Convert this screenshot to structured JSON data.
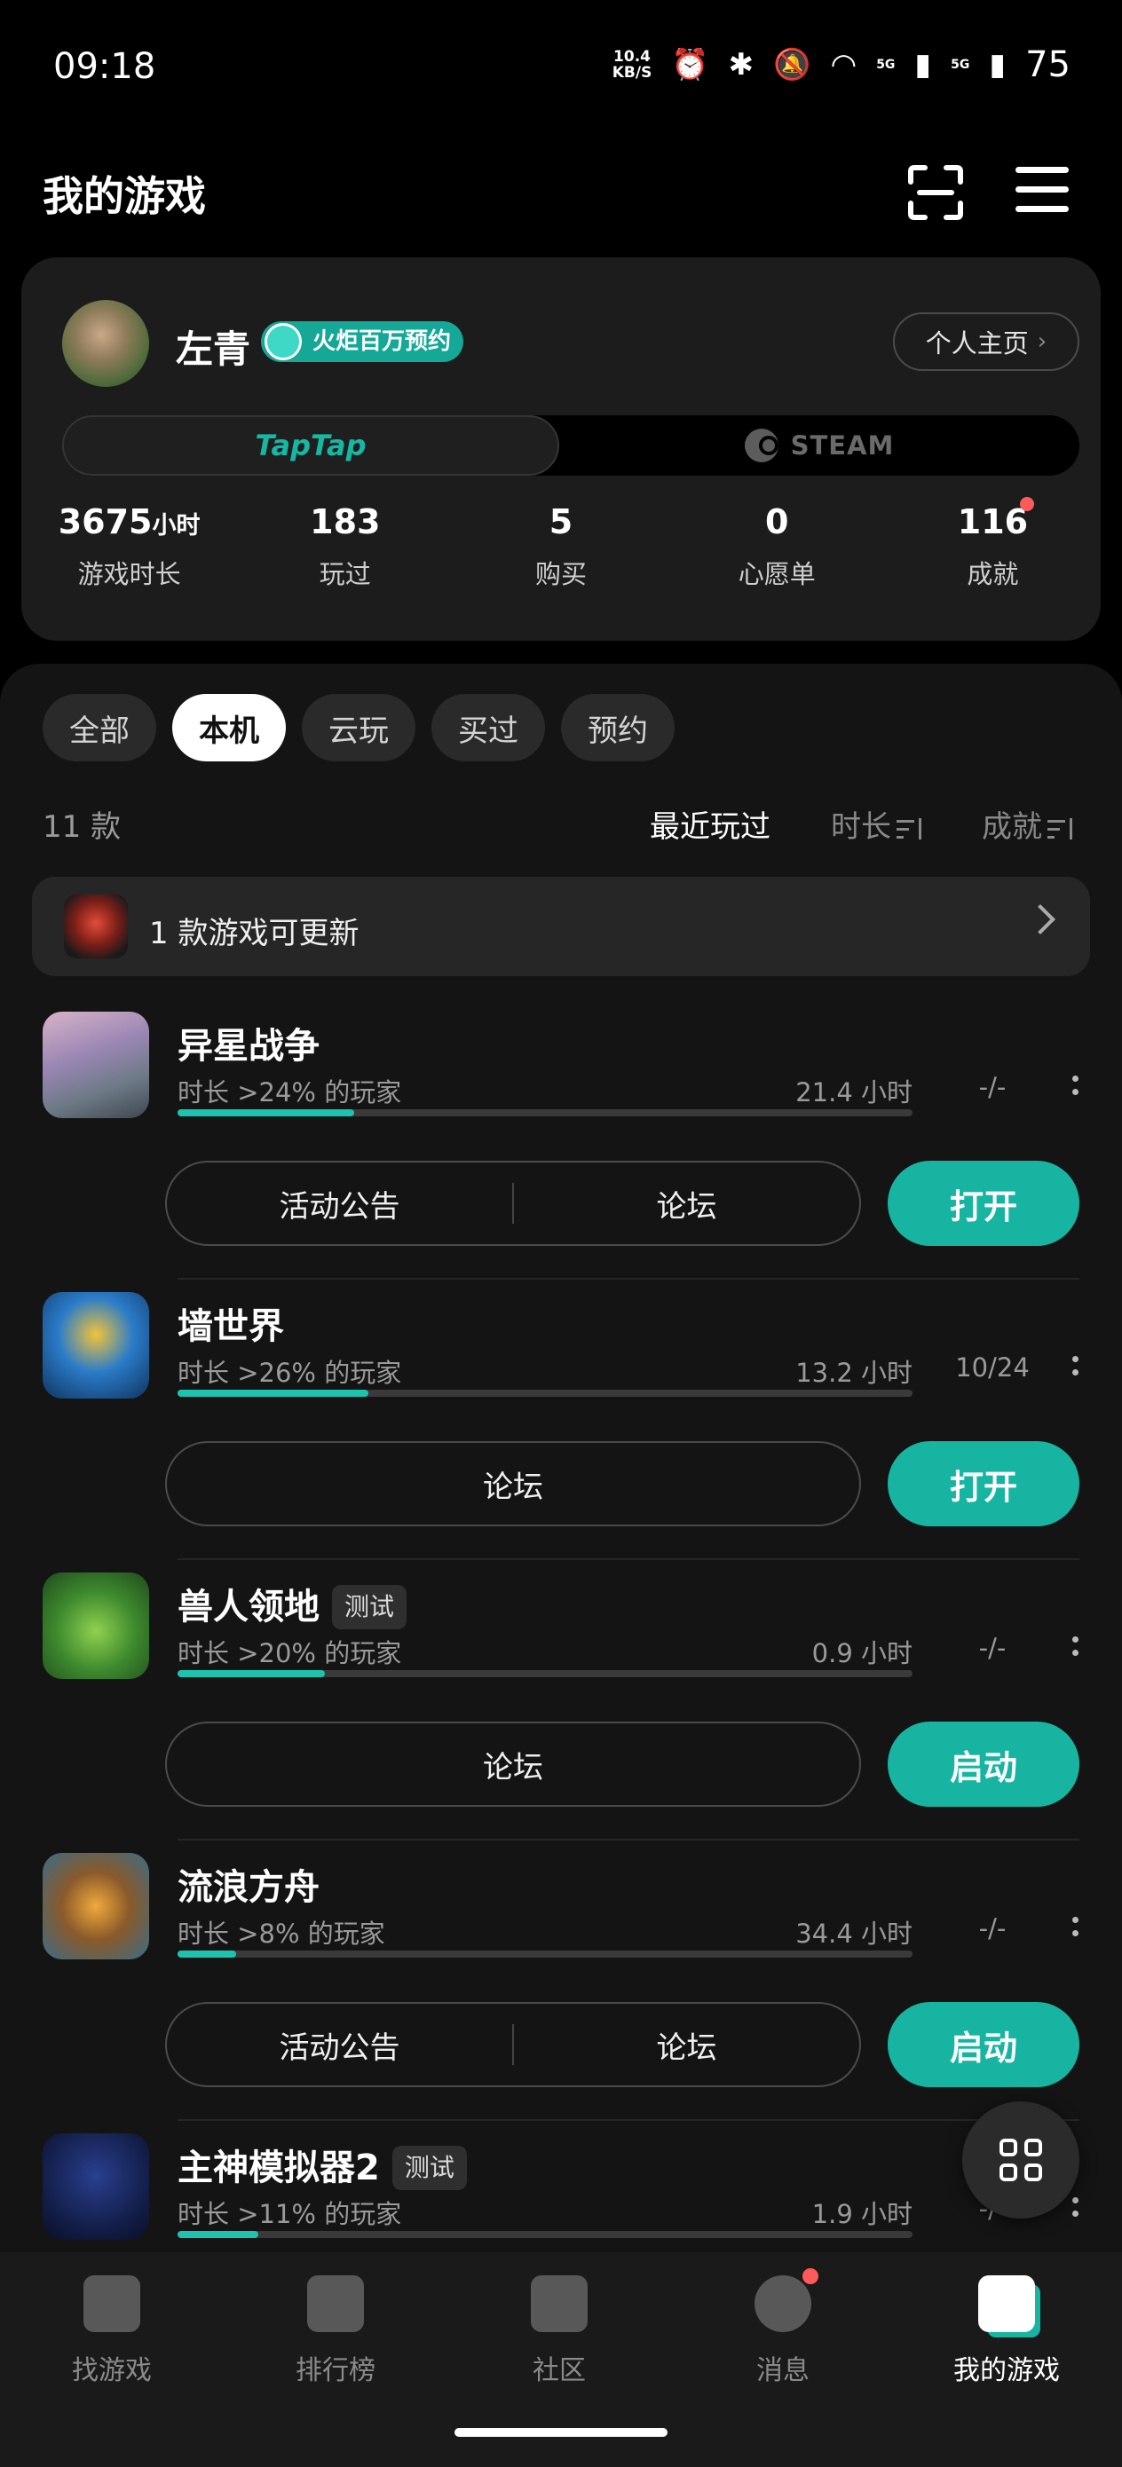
{
  "status_bar": {
    "time": "09:18",
    "net_speed_value": "10.4",
    "net_speed_unit": "KB/S",
    "sim1": "5G",
    "sim2": "5G",
    "battery": "75"
  },
  "header": {
    "title": "我的游戏"
  },
  "profile": {
    "username": "左青",
    "badge": "火炬百万预约",
    "home_button": "个人主页",
    "platforms": {
      "taptap": "TapTap",
      "steam": "STEAM"
    },
    "stats": [
      {
        "value": "3675",
        "unit": "小时",
        "label": "游戏时长"
      },
      {
        "value": "183",
        "unit": "",
        "label": "玩过"
      },
      {
        "value": "5",
        "unit": "",
        "label": "购买"
      },
      {
        "value": "0",
        "unit": "",
        "label": "心愿单"
      },
      {
        "value": "116",
        "unit": "",
        "label": "成就"
      }
    ]
  },
  "filters": {
    "tabs": [
      "全部",
      "本机",
      "云玩",
      "买过",
      "预约"
    ],
    "active_index": 1
  },
  "list_meta": {
    "count": "11 款",
    "sort_recent": "最近玩过",
    "sort_duration": "时长",
    "sort_achievement": "成就"
  },
  "update_bar": {
    "text": "1 款游戏可更新"
  },
  "games": [
    {
      "name": "异星战争",
      "tag": "",
      "percentile": "时长 >24% 的玩家",
      "progress": 0.24,
      "hours": "21.4 小时",
      "achievements": "-/-",
      "buttons": [
        "活动公告",
        "论坛"
      ],
      "action": "打开"
    },
    {
      "name": "墙世界",
      "tag": "",
      "percentile": "时长 >26% 的玩家",
      "progress": 0.26,
      "hours": "13.2 小时",
      "achievements": "10/24",
      "buttons": [
        "论坛"
      ],
      "action": "打开"
    },
    {
      "name": "兽人领地",
      "tag": "测试",
      "percentile": "时长 >20% 的玩家",
      "progress": 0.2,
      "hours": "0.9 小时",
      "achievements": "-/-",
      "buttons": [
        "论坛"
      ],
      "action": "启动"
    },
    {
      "name": "流浪方舟",
      "tag": "",
      "percentile": "时长 >8% 的玩家",
      "progress": 0.08,
      "hours": "34.4 小时",
      "achievements": "-/-",
      "buttons": [
        "活动公告",
        "论坛"
      ],
      "action": "启动"
    },
    {
      "name": "主神模拟器2",
      "tag": "测试",
      "percentile": "时长 >11% 的玩家",
      "progress": 0.11,
      "hours": "1.9 小时",
      "achievements": "-/-",
      "buttons": [],
      "action": ""
    }
  ],
  "bottom_nav": [
    {
      "label": "找游戏",
      "icon": "find-game-icon"
    },
    {
      "label": "排行榜",
      "icon": "ranking-icon"
    },
    {
      "label": "社区",
      "icon": "community-icon"
    },
    {
      "label": "消息",
      "icon": "message-icon"
    },
    {
      "label": "我的游戏",
      "icon": "my-games-icon"
    }
  ],
  "colors": {
    "accent": "#17b5a1",
    "badge": "#15a896",
    "notification_dot": "#ff5a5a"
  }
}
